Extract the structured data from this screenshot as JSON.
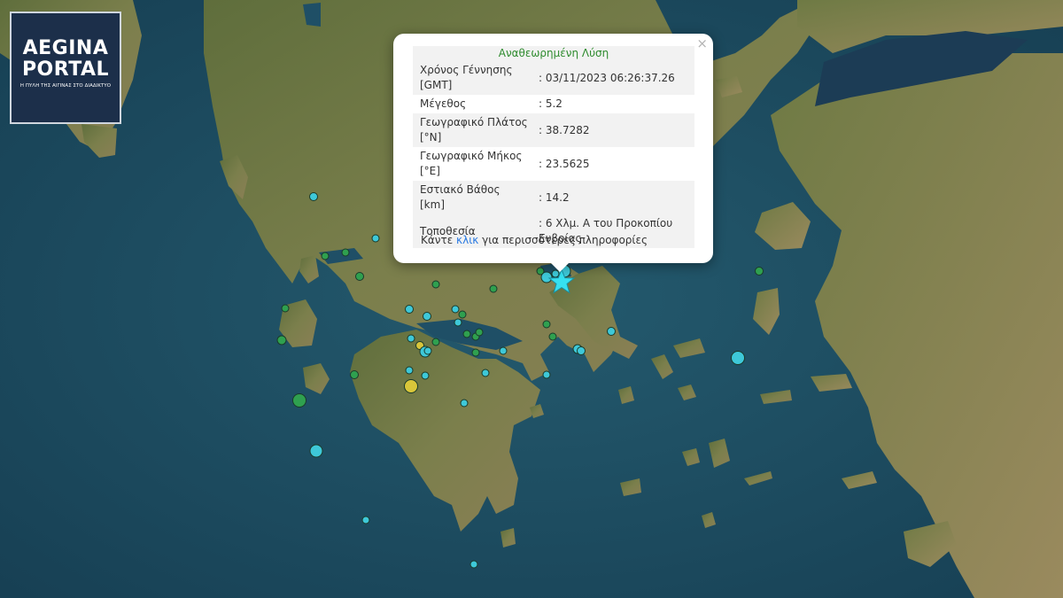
{
  "logo": {
    "line1": "AEGINA",
    "line2": "PORTAL",
    "tagline": "Η ΠΥΛΗ ΤΗΣ ΑΙΓΙΝΑΣ ΣΤΟ ΔΙΑΔΙΚΤΥΟ"
  },
  "popup": {
    "title": "Αναθεωρημένη Λύση",
    "close_symbol": "×",
    "rows": [
      {
        "label": "Χρόνος Γέννησης [GMT]",
        "value": ": 03/11/2023 06:26:37.26"
      },
      {
        "label": "Μέγεθος",
        "value": ": 5.2"
      },
      {
        "label": "Γεωγραφικό Πλάτος [°N]",
        "value": ": 38.7282"
      },
      {
        "label": "Γεωγραφικό Μήκος [°E]",
        "value": ": 23.5625"
      },
      {
        "label": "Εστιακό Βάθος [km]",
        "value": ": 14.2"
      },
      {
        "label": "Τοποθεσία",
        "value": ": 6 Χλμ. Α του Προκοπίου Ευβοίας"
      }
    ],
    "more_prefix": "Κάντε ",
    "more_link": "κλικ",
    "more_suffix": " για περισσότερες πληροφορίες"
  },
  "map_colors": {
    "sea": "#1d4a5e",
    "land": "#6f7d47",
    "cyan_marker": "#3ec8d8",
    "green_marker": "#2fa04f",
    "yellow_marker": "#d9c63a",
    "epicenter_star": "#36e0f0"
  },
  "markers_legend": {
    "epicenter_icon": "star-icon"
  }
}
